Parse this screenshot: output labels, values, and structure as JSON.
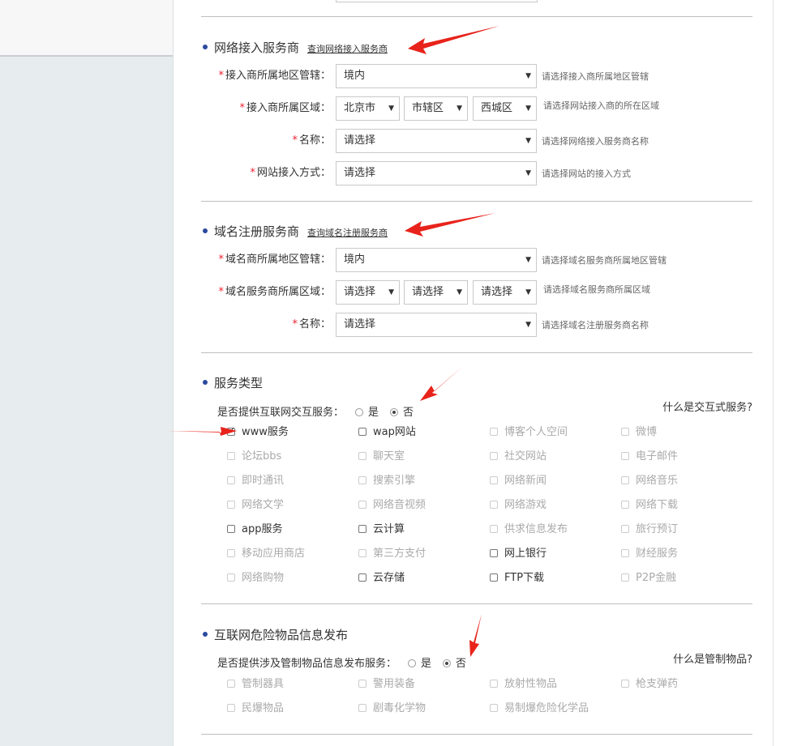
{
  "isp": {
    "title": "网络接入服务商",
    "link": "查询网络接入服务商",
    "rows": [
      {
        "label": "接入商所属地区管辖：",
        "value": "境内",
        "hint": "请选择接入商所属地区管辖"
      },
      {
        "label": "接入商所属区域：",
        "values": [
          "北京市",
          "市辖区",
          "西城区"
        ],
        "hint": "请选择网站接入商的所在区域"
      },
      {
        "label": "名称：",
        "value": "请选择",
        "hint": "请选择网络接入服务商名称"
      },
      {
        "label": "网站接入方式：",
        "value": "请选择",
        "hint": "请选择网站的接入方式"
      }
    ]
  },
  "domain": {
    "title": "域名注册服务商",
    "link": "查询域名注册服务商",
    "rows": [
      {
        "label": "域名商所属地区管辖：",
        "value": "境内",
        "hint": "请选择域名服务商所属地区管辖"
      },
      {
        "label": "域名服务商所属区域：",
        "values": [
          "请选择",
          "请选择",
          "请选择"
        ],
        "hint": "请选择域名服务商所属区域"
      },
      {
        "label": "名称：",
        "value": "请选择",
        "hint": "请选择域名注册服务商名称"
      }
    ]
  },
  "service": {
    "title": "服务类型",
    "question": "是否提供互联网交互服务：",
    "yes": "是",
    "no": "否",
    "selected": "no",
    "whatis": "什么是交互式服务?",
    "items": [
      {
        "label": "www服务",
        "state": "checked"
      },
      {
        "label": "wap网站",
        "state": "enabled"
      },
      {
        "label": "博客个人空间",
        "state": "disabled"
      },
      {
        "label": "微博",
        "state": "disabled"
      },
      {
        "label": "论坛bbs",
        "state": "disabled"
      },
      {
        "label": "聊天室",
        "state": "disabled"
      },
      {
        "label": "社交网站",
        "state": "disabled"
      },
      {
        "label": "电子邮件",
        "state": "disabled"
      },
      {
        "label": "即时通讯",
        "state": "disabled"
      },
      {
        "label": "搜索引擎",
        "state": "disabled"
      },
      {
        "label": "网络新闻",
        "state": "disabled"
      },
      {
        "label": "网络音乐",
        "state": "disabled"
      },
      {
        "label": "网络文学",
        "state": "disabled"
      },
      {
        "label": "网络音视频",
        "state": "disabled"
      },
      {
        "label": "网络游戏",
        "state": "disabled"
      },
      {
        "label": "网络下载",
        "state": "disabled"
      },
      {
        "label": "app服务",
        "state": "enabled"
      },
      {
        "label": "云计算",
        "state": "enabled"
      },
      {
        "label": "供求信息发布",
        "state": "disabled"
      },
      {
        "label": "旅行预订",
        "state": "disabled"
      },
      {
        "label": "移动应用商店",
        "state": "disabled"
      },
      {
        "label": "第三方支付",
        "state": "disabled"
      },
      {
        "label": "网上银行",
        "state": "enabled"
      },
      {
        "label": "财经服务",
        "state": "disabled"
      },
      {
        "label": "网络购物",
        "state": "disabled"
      },
      {
        "label": "云存储",
        "state": "enabled"
      },
      {
        "label": "FTP下载",
        "state": "enabled"
      },
      {
        "label": "P2P金融",
        "state": "disabled"
      }
    ]
  },
  "danger": {
    "title": "互联网危险物品信息发布",
    "question": "是否提供涉及管制物品信息发布服务：",
    "yes": "是",
    "no": "否",
    "selected": "no",
    "whatis": "什么是管制物品?",
    "items": [
      {
        "label": "管制器具",
        "state": "disabled"
      },
      {
        "label": "警用装备",
        "state": "disabled"
      },
      {
        "label": "放射性物品",
        "state": "disabled"
      },
      {
        "label": "枪支弹药",
        "state": "disabled"
      },
      {
        "label": "民爆物品",
        "state": "disabled"
      },
      {
        "label": "剧毒化学物",
        "state": "disabled"
      },
      {
        "label": "易制爆危险化学品",
        "state": "disabled"
      }
    ]
  },
  "colors": {
    "required": "#e22233",
    "arrow": "#e8231b",
    "bullet": "#2b4a9e"
  }
}
